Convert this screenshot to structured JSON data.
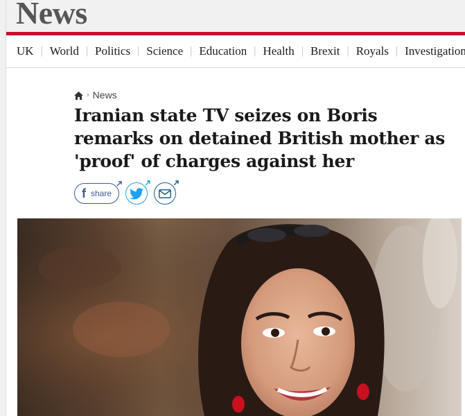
{
  "section": {
    "title": "News"
  },
  "nav": {
    "items": [
      "UK",
      "World",
      "Politics",
      "Science",
      "Education",
      "Health",
      "Brexit",
      "Royals",
      "Investigations"
    ]
  },
  "breadcrumb": {
    "label": "News"
  },
  "article": {
    "headline_lines": [
      "Iranian state TV seizes on Boris",
      "remarks on detained British mother as",
      "'proof' of charges against her"
    ]
  },
  "share": {
    "facebook_label": "share"
  },
  "colors": {
    "brand_red": "#c8102e",
    "facebook": "#3b5998",
    "twitter": "#1da1f2",
    "email": "#1d5f8a"
  }
}
